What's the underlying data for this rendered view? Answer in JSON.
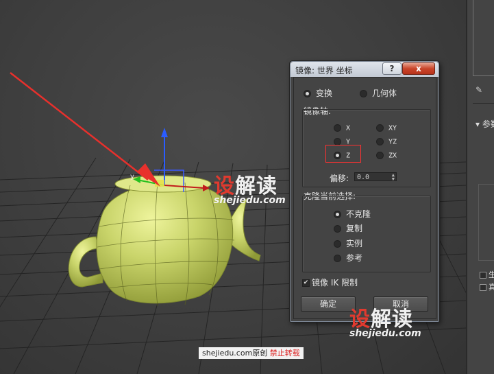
{
  "viewport": {
    "axis_y_label": "y",
    "icons": [
      "teapot-model",
      "transform-gizmo",
      "tutorial-arrow"
    ]
  },
  "dialog": {
    "title": "镜像: 世界 坐标",
    "help_label": "?",
    "close_label": "x",
    "mode": {
      "transform_label": "变换",
      "geometry_label": "几何体",
      "selected": "transform"
    },
    "mirror_axis": {
      "label": "镜像轴:",
      "x": "X",
      "y": "Y",
      "z": "Z",
      "xy": "XY",
      "yz": "YZ",
      "zx": "ZX",
      "selected": "Z",
      "offset_label": "偏移:",
      "offset_value": "0.0"
    },
    "clone": {
      "label": "克隆当前选择:",
      "no_clone": "不克隆",
      "copy": "复制",
      "instance": "实例",
      "reference": "参考",
      "selected": "no_clone"
    },
    "ik_label": "镜像 IK 限制",
    "ik_checked": true,
    "ok_label": "确定",
    "cancel_label": "取消"
  },
  "command_panel": {
    "rollout_label": "参数",
    "check1_label": "生",
    "check2_label": "真"
  },
  "watermarks": {
    "logo_part1": "设",
    "logo_part2": "解读",
    "url": "shejiedu.com"
  },
  "credit": {
    "text": "shejiedu.com原创",
    "warning": "禁止转载"
  },
  "colors": {
    "viewport_bg": "#3e3e3e",
    "teapot": "#c8d46a",
    "arrow": "#e8302c",
    "dialog_bg": "#444444",
    "highlight": "#ff3131"
  }
}
